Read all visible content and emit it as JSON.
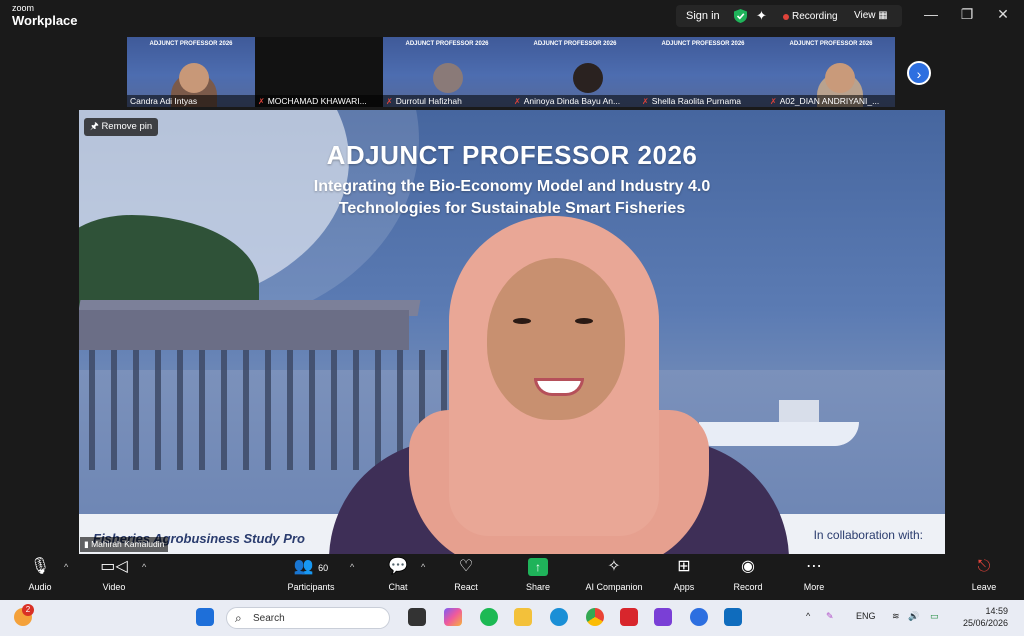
{
  "titlebar": {
    "brand_small": "zoom",
    "brand": "Workplace",
    "sign_in": "Sign in",
    "recording": "Recording",
    "view": "View"
  },
  "thumbnails": [
    {
      "name": "Candra Adi Intyas",
      "muted": false
    },
    {
      "name": "MOCHAMAD KHAWARI...",
      "muted": true
    },
    {
      "name": "Durrotul Hafizhah",
      "muted": true
    },
    {
      "name": "Aninoya Dinda Bayu An...",
      "muted": true
    },
    {
      "name": "Shella Raolita Purnama",
      "muted": true
    },
    {
      "name": "A02_DIAN ANDRIYANI_...",
      "muted": true
    }
  ],
  "slide": {
    "title": "ADJUNCT PROFESSOR 2026",
    "subtitle_line1": "Integrating the Bio-Economy Model and Industry 4.0",
    "subtitle_line2": "Technologies for Sustainable Smart Fisheries",
    "footer_left": "Fisheries Agrobusiness Study Pro",
    "footer_right": "In collaboration with:"
  },
  "remove_pin": "Remove pin",
  "active_speaker": "Mahirah Kamaludin",
  "toolbar": {
    "audio": "Audio",
    "video": "Video",
    "participants": "Participants",
    "participants_count": "60",
    "chat": "Chat",
    "react": "React",
    "share": "Share",
    "ai_companion": "AI Companion",
    "apps": "Apps",
    "record": "Record",
    "more": "More",
    "leave": "Leave"
  },
  "taskbar": {
    "search_placeholder": "Search",
    "notification_count": "2",
    "language": "ENG",
    "time": "14:59",
    "date": "25/06/2026"
  },
  "colors": {
    "accent_blue": "#2d6fe0",
    "share_green": "#1fb35a",
    "record_red": "#e0433a"
  }
}
